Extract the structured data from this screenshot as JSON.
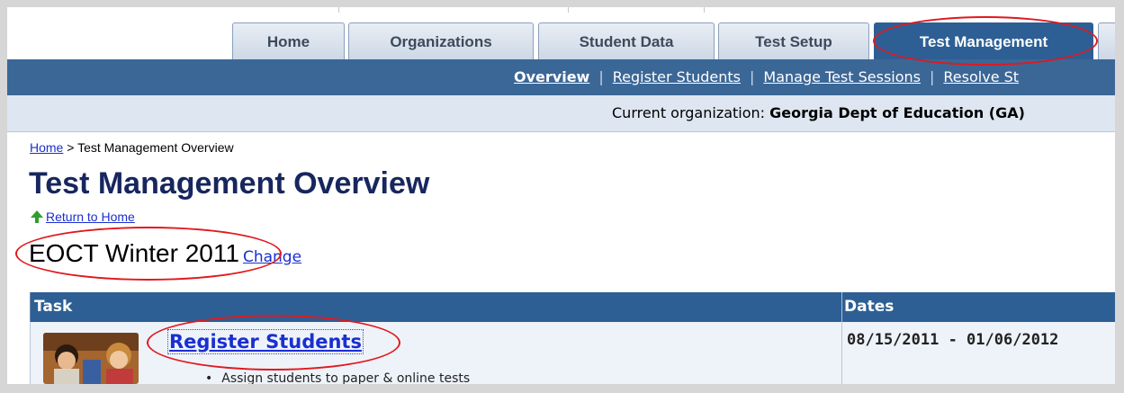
{
  "tabs": [
    {
      "label": "Home",
      "active": false
    },
    {
      "label": "Organizations",
      "active": false
    },
    {
      "label": "Student Data",
      "active": false
    },
    {
      "label": "Test Setup",
      "active": false
    },
    {
      "label": "Test Management",
      "active": true
    }
  ],
  "subnav": {
    "items": [
      {
        "label": "Overview",
        "current": true
      },
      {
        "label": "Register Students",
        "current": false
      },
      {
        "label": "Manage Test Sessions",
        "current": false
      },
      {
        "label": "Resolve St",
        "current": false
      }
    ]
  },
  "org": {
    "label": "Current organization:",
    "value": "Georgia Dept of Education (GA)"
  },
  "breadcrumb": {
    "home": "Home",
    "separator": ">",
    "current": "Test Management Overview"
  },
  "page_title": "Test Management Overview",
  "return_link": {
    "label": "Return to Home",
    "icon": "up-arrow-icon",
    "icon_color": "#2e9e2e"
  },
  "administration": {
    "name": "EOCT Winter 2011",
    "change_label": "Change"
  },
  "table": {
    "headers": {
      "task": "Task",
      "dates": "Dates"
    },
    "rows": [
      {
        "task": "Register Students",
        "description": "Assign students to paper & online tests",
        "dates": "08/15/2011 - 01/06/2012"
      }
    ]
  },
  "colors": {
    "nav_blue": "#3b6797",
    "active_tab": "#2d5f94",
    "title": "#17265e",
    "link": "#1a2fd0",
    "highlight": "#e0191e"
  }
}
